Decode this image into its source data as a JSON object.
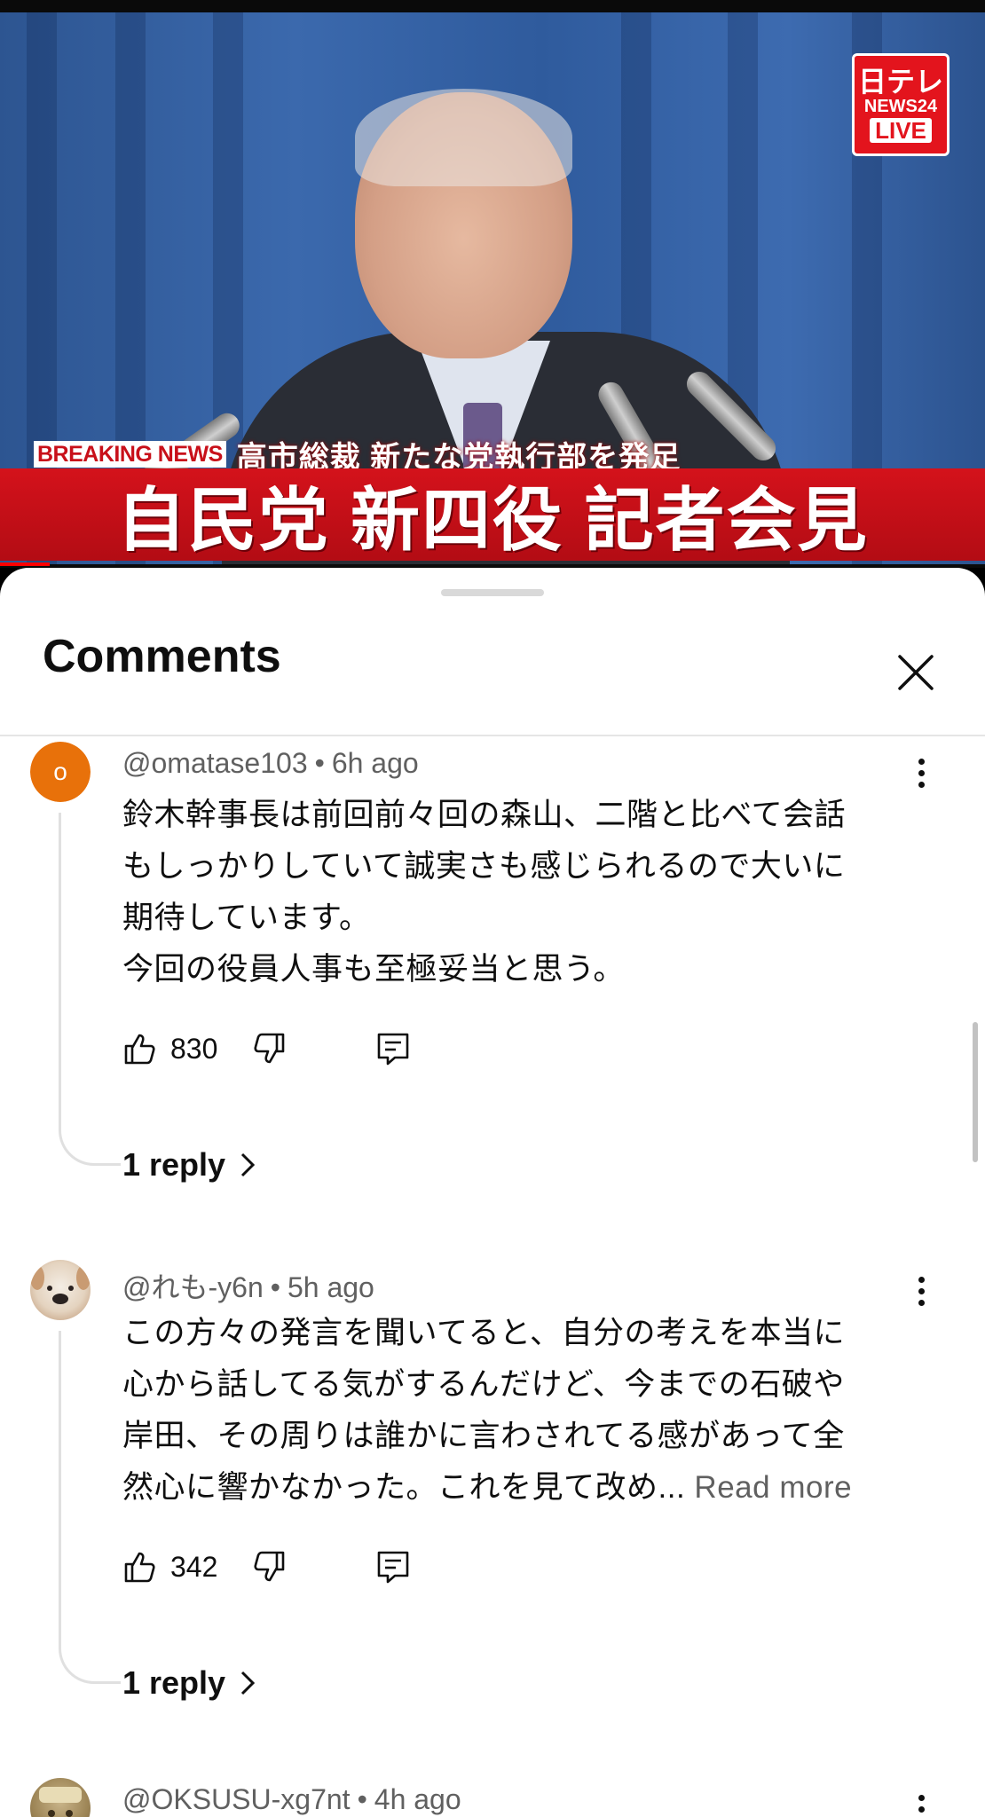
{
  "video": {
    "logo": {
      "top": "日テレ",
      "mid": "NEWS24",
      "live": "LIVE"
    },
    "breaking_label": "BREAKING NEWS",
    "breaking_sub": "高市総裁 新たな党執行部を発足",
    "headline": "自民党 新四役 記者会見"
  },
  "sheet": {
    "title": "Comments"
  },
  "comments": [
    {
      "author": "@omatase103",
      "time": "6h ago",
      "avatar_letter": "o",
      "avatar_color": "#e8710a",
      "lines": [
        "鈴木幹事長は前回前々回の森山、二階と比べて会話",
        "もしっかりしていて誠実さも感じられるので大いに",
        "期待しています。",
        "今回の役員人事も至極妥当と思う。"
      ],
      "likes": "830",
      "replies": "1 reply"
    },
    {
      "author": "@れも-y6n",
      "time": "5h ago",
      "lines": [
        "この方々の発言を聞いてると、自分の考えを本当に",
        "心から話してる気がするんだけど、今までの石破や",
        "岸田、その周りは誰かに言わされてる感があって全",
        "然心に響かなかった。これを見て改め..."
      ],
      "read_more": "Read more",
      "likes": "342",
      "replies": "1 reply"
    },
    {
      "author": "@OKSUSU-xg7nt",
      "time": "4h ago"
    }
  ]
}
